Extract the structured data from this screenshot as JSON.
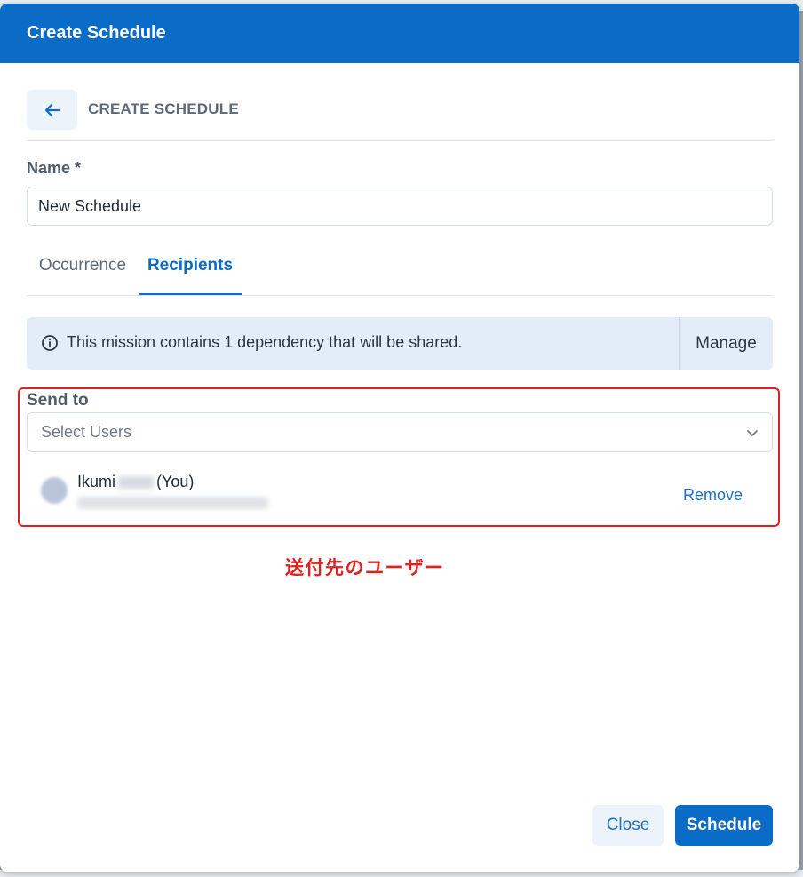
{
  "modal": {
    "title": "Create Schedule"
  },
  "header": {
    "back_label": "CREATE SCHEDULE"
  },
  "form": {
    "name_label": "Name *",
    "name_value": "New Schedule"
  },
  "tabs": [
    {
      "label": "Occurrence",
      "active": false
    },
    {
      "label": "Recipients",
      "active": true
    }
  ],
  "info": {
    "text": "This mission contains 1 dependency that will be shared.",
    "manage_label": "Manage"
  },
  "send_to": {
    "label": "Send to",
    "placeholder": "Select Users",
    "users": [
      {
        "first_name": "Ikumi",
        "suffix": "(You)",
        "remove_label": "Remove"
      }
    ]
  },
  "annotation": {
    "text": "送付先のユーザー"
  },
  "footer": {
    "close_label": "Close",
    "schedule_label": "Schedule"
  },
  "colors": {
    "primary": "#0b6cc7",
    "annotation_red": "#e0201f",
    "info_bg": "#e2edf9"
  }
}
